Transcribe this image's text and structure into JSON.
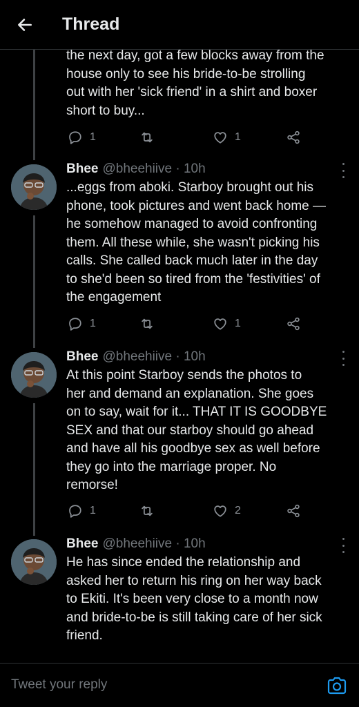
{
  "header": {
    "title": "Thread"
  },
  "tweets": [
    {
      "body_lines": [
        "the next day, got a few blocks away from the",
        "house only to see his bride-to-be strolling",
        "out with her 'sick friend' in a shirt and boxer",
        "short to buy..."
      ],
      "reply_count": "1",
      "like_count": "1"
    },
    {
      "name": "Bhee",
      "handle": "@bheehiive · 10h",
      "body_lines": [
        "...eggs from aboki. Starboy brought out his",
        "phone, took pictures and went back home —",
        "he somehow managed to avoid confronting",
        "them. All these while, she wasn't picking his",
        "calls. She called back much later in the day",
        "to she'd been so tired from the 'festivities' of",
        "the engagement"
      ],
      "reply_count": "1",
      "like_count": "1"
    },
    {
      "name": "Bhee",
      "handle": "@bheehiive · 10h",
      "body_lines": [
        "At this point Starboy sends the photos to",
        "her and demand an explanation. She goes",
        "on to say, wait for it... THAT IT IS GOODBYE",
        "SEX and that our starboy should go ahead",
        "and have all his goodbye sex as well before",
        "they go into the marriage proper. No",
        "remorse!"
      ],
      "reply_count": "1",
      "like_count": "2"
    },
    {
      "name": "Bhee",
      "handle": "@bheehiive · 10h",
      "body_lines": [
        "He has since ended the relationship and",
        "asked her to return his ring on her way back",
        "to Ekiti. It's been very close to a month now",
        "and bride-to-be is still taking care of her sick",
        "friend."
      ]
    }
  ],
  "reply_bar": {
    "placeholder": "Tweet your reply"
  },
  "colors": {
    "background": "#000000",
    "text": "#e7e9ea",
    "muted": "#71767b",
    "accent": "#1d9bf0"
  },
  "icons": [
    "back-arrow-icon",
    "reply-icon",
    "retweet-icon",
    "like-icon",
    "share-icon",
    "more-icon",
    "camera-icon"
  ]
}
